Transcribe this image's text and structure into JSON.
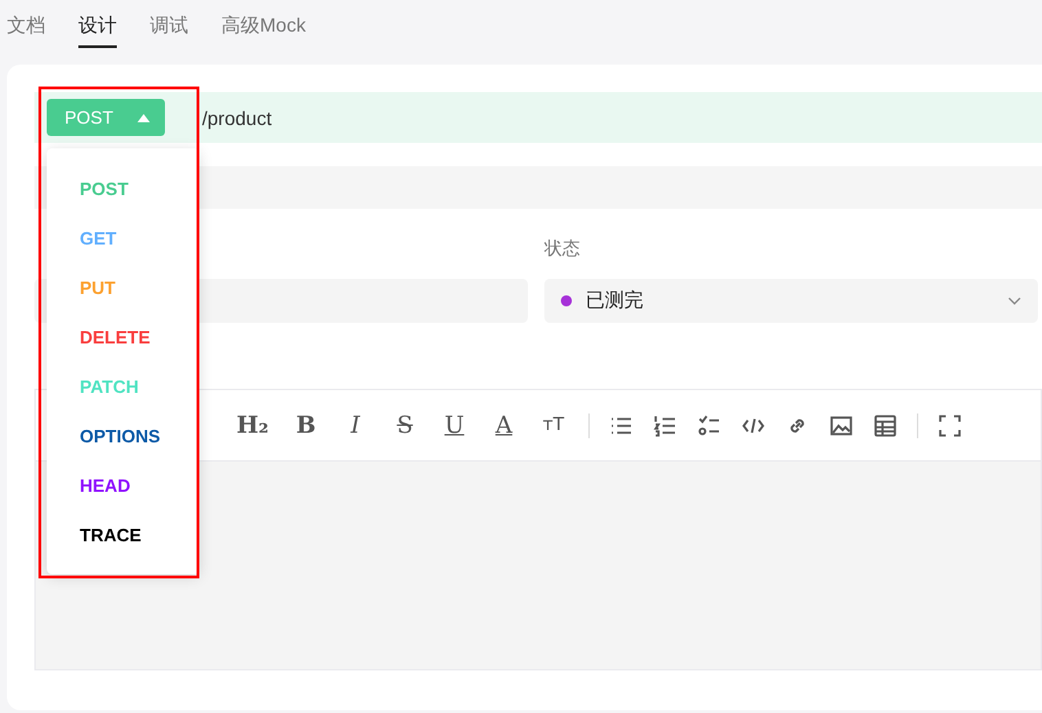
{
  "tabs": [
    {
      "label": "文档",
      "selected": false
    },
    {
      "label": "设计",
      "selected": true
    },
    {
      "label": "调试",
      "selected": false
    },
    {
      "label": "高级Mock",
      "selected": false
    }
  ],
  "request": {
    "method": "POST",
    "path": "/product"
  },
  "method_menu": {
    "expanded": true,
    "items": [
      {
        "label": "POST",
        "color": "#49cc90"
      },
      {
        "label": "GET",
        "color": "#61affe"
      },
      {
        "label": "PUT",
        "color": "#fca130"
      },
      {
        "label": "DELETE",
        "color": "#f93e3e"
      },
      {
        "label": "PATCH",
        "color": "#50e3c2"
      },
      {
        "label": "OPTIONS",
        "color": "#0d5aa7"
      },
      {
        "label": "HEAD",
        "color": "#9012fe"
      },
      {
        "label": "TRACE",
        "color": "#000000"
      }
    ]
  },
  "status": {
    "label": "状态",
    "value": "已测完",
    "color": "#a631d8"
  },
  "toolbar": [
    {
      "kind": "text",
      "label": "H₂"
    },
    {
      "kind": "text",
      "label": "B"
    },
    {
      "kind": "text",
      "label": "I"
    },
    {
      "kind": "text",
      "label": "S"
    },
    {
      "kind": "text",
      "label": "U"
    },
    {
      "kind": "text",
      "label": "A"
    },
    {
      "kind": "text",
      "label": "ᴛT"
    },
    {
      "kind": "sep"
    },
    {
      "kind": "ul"
    },
    {
      "kind": "ol"
    },
    {
      "kind": "task"
    },
    {
      "kind": "code"
    },
    {
      "kind": "link"
    },
    {
      "kind": "image"
    },
    {
      "kind": "table"
    },
    {
      "kind": "sep"
    },
    {
      "kind": "fullscreen"
    }
  ]
}
